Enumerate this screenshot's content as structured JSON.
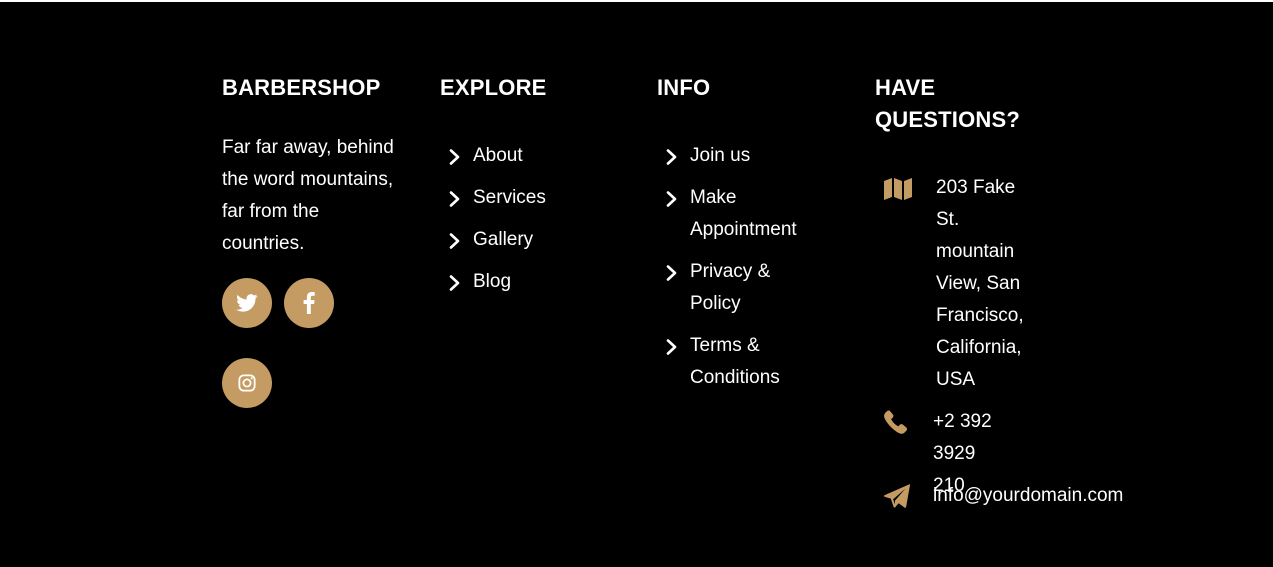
{
  "brand": {
    "heading": "BARBERSHOP",
    "description": "Far far away, behind the word mountains, far from the countries."
  },
  "social": [
    {
      "name": "twitter",
      "icon": "twitter-icon"
    },
    {
      "name": "facebook",
      "icon": "facebook-icon"
    },
    {
      "name": "instagram",
      "icon": "instagram-icon"
    }
  ],
  "explore": {
    "heading": "EXPLORE",
    "links": [
      "About",
      "Services",
      "Gallery",
      "Blog"
    ]
  },
  "info": {
    "heading": "INFO",
    "links": [
      "Join us",
      "Make Appointment",
      "Privacy & Policy",
      "Terms & Conditions"
    ]
  },
  "contact": {
    "heading": "HAVE QUESTIONS?",
    "address": "203 Fake St. mountain View, San Francisco, California, USA",
    "phone": "+2 392 3929 210",
    "email": "info@yourdomain.com",
    "icons": [
      "map-icon",
      "phone-icon",
      "paper-plane-icon"
    ]
  },
  "colors": {
    "background": "#000000",
    "accent": "#c49b63",
    "text": "#ffffff"
  }
}
